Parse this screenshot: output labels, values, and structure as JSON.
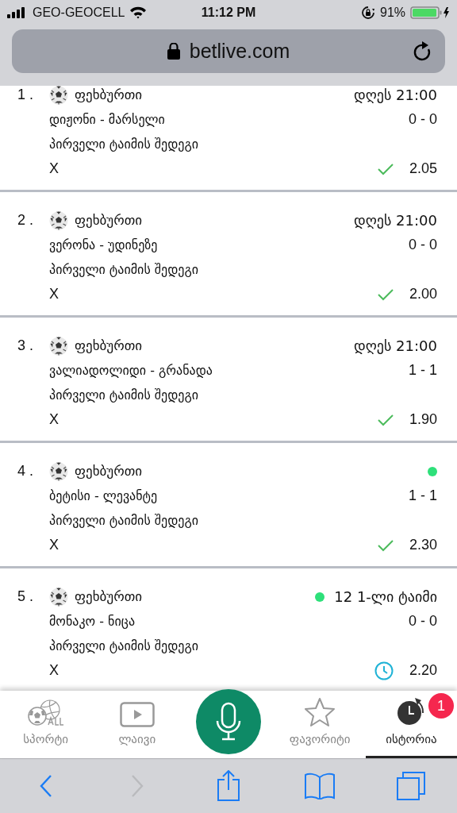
{
  "status_bar": {
    "carrier": "GEO-GEOCELL",
    "time": "11:12 PM",
    "battery": "91%"
  },
  "address_bar": {
    "url": "betlive.com"
  },
  "bets": [
    {
      "number": "1 .",
      "sport": "ფეხბურთი",
      "live": false,
      "time": "დღეს 21:00",
      "teams": "დიჟონი - მარსელი",
      "score": "0 - 0",
      "market": "პირველი ტაიმის შედეგი",
      "pick": "X",
      "settled": true,
      "odds": "2.05"
    },
    {
      "number": "2 .",
      "sport": "ფეხბურთი",
      "live": false,
      "time": "დღეს 21:00",
      "teams": "ვერონა - უდინეზე",
      "score": "0 - 0",
      "market": "პირველი ტაიმის შედეგი",
      "pick": "X",
      "settled": true,
      "odds": "2.00"
    },
    {
      "number": "3 .",
      "sport": "ფეხბურთი",
      "live": false,
      "time": "დღეს 21:00",
      "teams": "ვალიადოლიდი - გრანადა",
      "score": "1 - 1",
      "market": "პირველი ტაიმის შედეგი",
      "pick": "X",
      "settled": true,
      "odds": "1.90"
    },
    {
      "number": "4 .",
      "sport": "ფეხბურთი",
      "live": true,
      "teams": "ბეტისი - ლევანტე",
      "score": "1 - 1",
      "market": "პირველი ტაიმის შედეგი",
      "pick": "X",
      "settled": true,
      "odds": "2.30"
    },
    {
      "number": "5 .",
      "sport": "ფეხბურთი",
      "live": true,
      "time": "12 1-ლი ტაიმი",
      "teams": "მონაკო - ნიცა",
      "score": "0 - 0",
      "market": "პირველი ტაიმის შედეგი",
      "pick": "X",
      "settled": false,
      "odds": "2.20"
    }
  ],
  "bottom_nav": [
    {
      "kind": "sports",
      "label": "სპორტი",
      "selected": false
    },
    {
      "kind": "live",
      "label": "ლაივი",
      "selected": false
    },
    {
      "kind": "mic"
    },
    {
      "kind": "favorites",
      "label": "ფავორიტი",
      "selected": false
    },
    {
      "kind": "history",
      "label": "ისტორია",
      "selected": true,
      "badge": "1"
    }
  ]
}
